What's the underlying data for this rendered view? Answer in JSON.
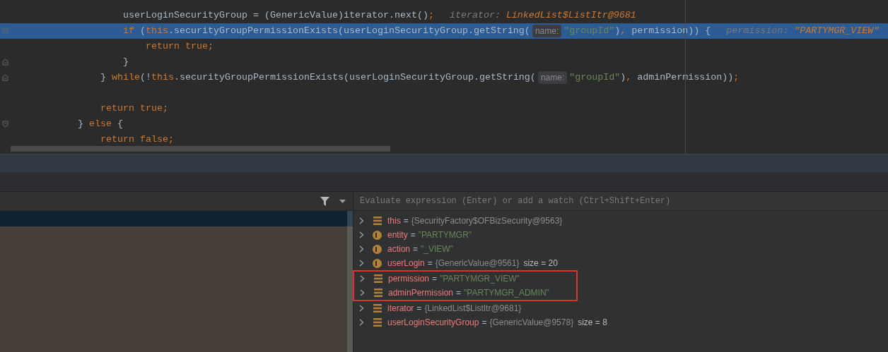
{
  "editor": {
    "lines": [
      {
        "selected": false,
        "fold_start": false,
        "fold_end": false,
        "tokens": [
          {
            "kind": "plain",
            "text": "            userLoginSecurityGroup = (GenericValue)iterator.next()"
          },
          {
            "kind": "keyword",
            "text": ";"
          },
          {
            "kind": "hint_label",
            "text": "iterator:"
          },
          {
            "kind": "hint_value",
            "text": "LinkedList$ListItr@9681"
          }
        ]
      },
      {
        "selected": true,
        "fold_start": true,
        "fold_end": false,
        "tokens": [
          {
            "kind": "keyword",
            "text": "            if "
          },
          {
            "kind": "plain",
            "text": "("
          },
          {
            "kind": "keyword",
            "text": "this"
          },
          {
            "kind": "plain",
            "text": ".securityGroupPermissionExists(userLoginSecurityGroup.getString("
          },
          {
            "kind": "param_hint",
            "text": "name:"
          },
          {
            "kind": "string",
            "text": "\"groupId\""
          },
          {
            "kind": "plain",
            "text": ")"
          },
          {
            "kind": "keyword",
            "text": ", "
          },
          {
            "kind": "plain",
            "text": "permission)) {"
          },
          {
            "kind": "hint_label",
            "text": "permission:"
          },
          {
            "kind": "hint_value",
            "text": "\"PARTYMGR_VIEW\""
          }
        ]
      },
      {
        "selected": false,
        "fold_start": false,
        "fold_end": false,
        "tokens": [
          {
            "kind": "keyword",
            "text": "                return true;"
          }
        ]
      },
      {
        "selected": false,
        "fold_start": false,
        "fold_end": true,
        "tokens": [
          {
            "kind": "plain",
            "text": "            }"
          }
        ]
      },
      {
        "selected": false,
        "fold_start": false,
        "fold_end": true,
        "tokens": [
          {
            "kind": "plain",
            "text": "        } "
          },
          {
            "kind": "keyword",
            "text": "while"
          },
          {
            "kind": "plain",
            "text": "(!"
          },
          {
            "kind": "keyword",
            "text": "this"
          },
          {
            "kind": "plain",
            "text": ".securityGroupPermissionExists(userLoginSecurityGroup.getString("
          },
          {
            "kind": "param_hint",
            "text": "name:"
          },
          {
            "kind": "string",
            "text": "\"groupId\""
          },
          {
            "kind": "plain",
            "text": ")"
          },
          {
            "kind": "keyword",
            "text": ", "
          },
          {
            "kind": "plain",
            "text": "adminPermission))"
          },
          {
            "kind": "keyword",
            "text": ";"
          }
        ]
      },
      {
        "selected": false,
        "fold_start": false,
        "fold_end": false
      },
      {
        "selected": false,
        "fold_start": false,
        "fold_end": false,
        "tokens": [
          {
            "kind": "keyword",
            "text": "        return true;"
          }
        ]
      },
      {
        "selected": false,
        "fold_start": true,
        "fold_end": false,
        "tokens": [
          {
            "kind": "plain",
            "text": "    } "
          },
          {
            "kind": "keyword",
            "text": "else "
          },
          {
            "kind": "plain",
            "text": "{"
          }
        ]
      },
      {
        "selected": false,
        "fold_start": false,
        "fold_end": false,
        "tokens": [
          {
            "kind": "keyword",
            "text": "        return false;"
          }
        ]
      }
    ]
  },
  "variables_panel": {
    "evaluate_field": {
      "placeholder": "Evaluate expression (Enter) or add a watch (Ctrl+Shift+Enter)"
    },
    "variables": [
      {
        "kind": "field",
        "name": "this",
        "operator": "=",
        "value": "{SecurityFactory$OFBizSecurity@9563}",
        "string_value": false,
        "highlighted": false
      },
      {
        "kind": "param",
        "name": "entity",
        "operator": "=",
        "value": "\"PARTYMGR\"",
        "string_value": true,
        "highlighted": false
      },
      {
        "kind": "param",
        "name": "action",
        "operator": "=",
        "value": "\"_VIEW\"",
        "string_value": true,
        "highlighted": false
      },
      {
        "kind": "param",
        "name": "userLogin",
        "operator": "=",
        "value": "{GenericValue@9561}",
        "string_value": false,
        "size": "size = 20",
        "highlighted": false
      },
      {
        "kind": "field",
        "name": "permission",
        "operator": "=",
        "value": "\"PARTYMGR_VIEW\"",
        "string_value": true,
        "highlighted": true
      },
      {
        "kind": "field",
        "name": "adminPermission",
        "operator": "=",
        "value": "\"PARTYMGR_ADMIN\"",
        "string_value": true,
        "highlighted": true
      },
      {
        "kind": "field",
        "name": "iterator",
        "operator": "=",
        "value": "{LinkedList$ListItr@9681}",
        "string_value": false,
        "highlighted": false
      },
      {
        "kind": "field",
        "name": "userLoginSecurityGroup",
        "operator": "=",
        "value": "{GenericValue@9578}",
        "string_value": false,
        "size": "size = 8",
        "highlighted": false
      }
    ]
  }
}
